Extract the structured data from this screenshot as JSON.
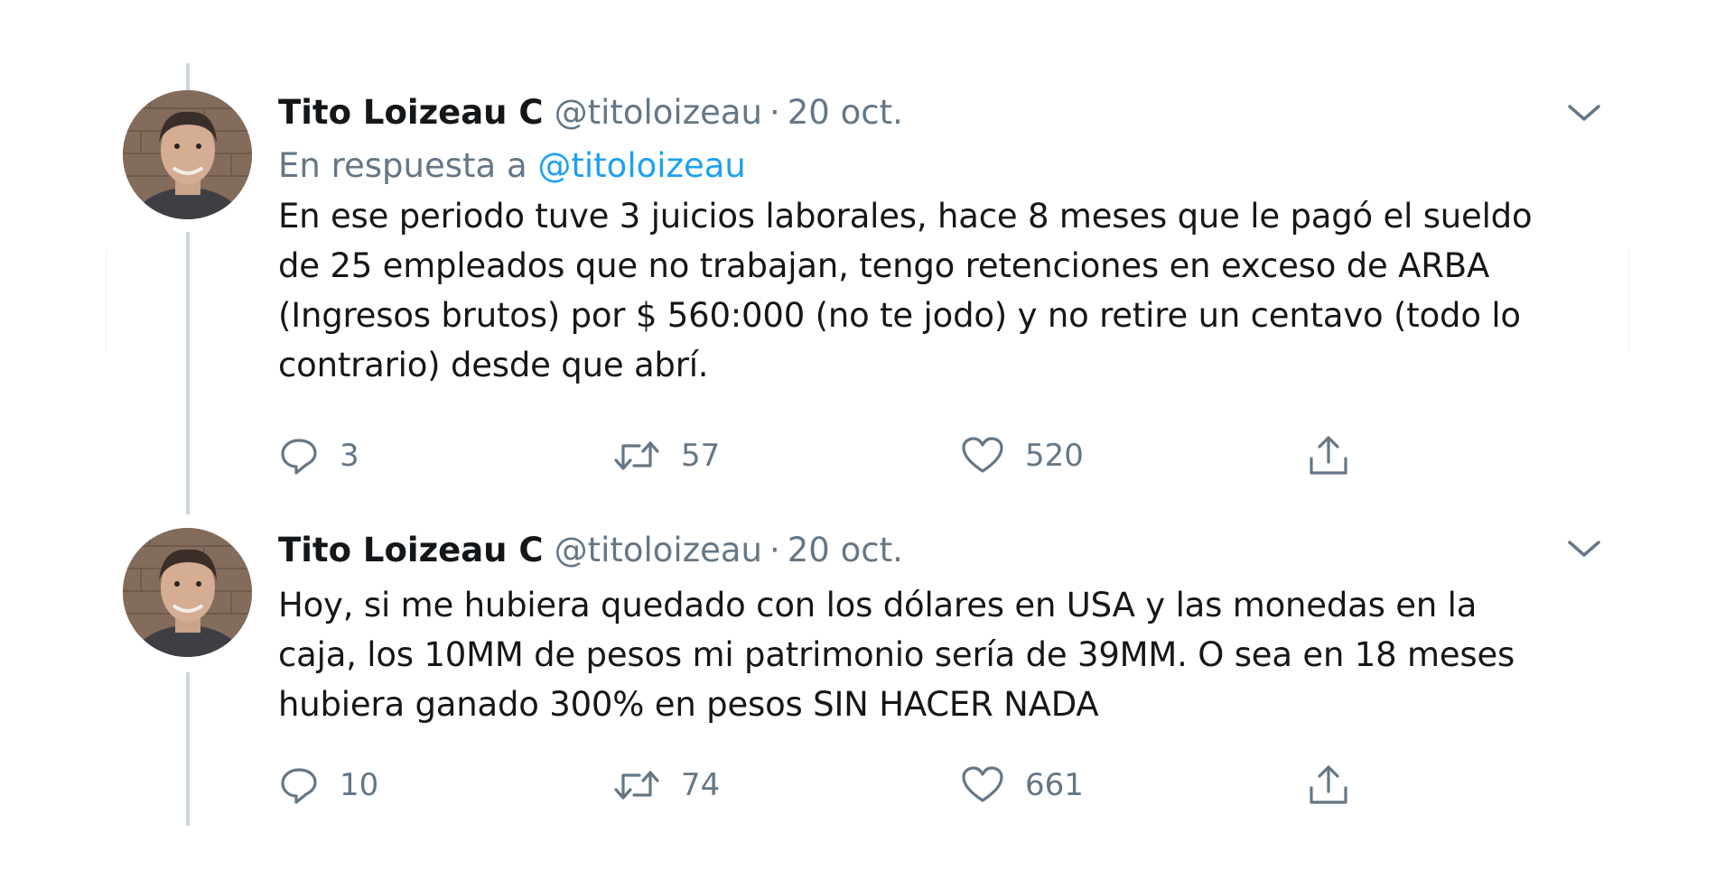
{
  "tweets": [
    {
      "author_name": "Tito Loizeau C",
      "handle": "@titoloizeau",
      "separator": "·",
      "date": "20 oct.",
      "reply_prefix": "En respuesta a",
      "reply_to": "@titoloizeau",
      "text": "En ese periodo tuve 3 juicios laborales, hace 8 meses que le pagó el sueldo\nde 25 empleados que no trabajan, tengo retenciones en exceso de ARBA\n(Ingresos brutos) por $ 560:000 (no te jodo) y no retire un centavo (todo lo\ncontrario) desde que abrí.",
      "replies": "3",
      "retweets": "57",
      "likes": "520"
    },
    {
      "author_name": "Tito Loizeau C",
      "handle": "@titoloizeau",
      "separator": "·",
      "date": "20 oct.",
      "text": "Hoy, si me hubiera quedado con los dólares en USA y las monedas en la\ncaja, los 10MM de pesos mi patrimonio sería de 39MM. O sea en 18 meses\nhubiera ganado 300% en pesos SIN HACER NADA",
      "replies": "10",
      "retweets": "74",
      "likes": "661"
    }
  ],
  "icons": {
    "reply": "reply-icon",
    "retweet": "retweet-icon",
    "like": "heart-icon",
    "share": "share-icon",
    "menu": "chevron-down-icon"
  },
  "colors": {
    "text": "#14171a",
    "muted": "#657786",
    "link": "#1da1f2",
    "thread_line": "#ccd6dd"
  }
}
